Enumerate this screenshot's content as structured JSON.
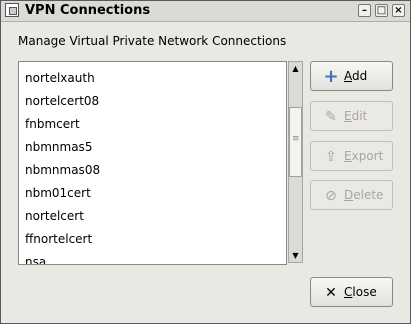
{
  "window": {
    "title": "VPN Connections"
  },
  "heading": "Manage Virtual Private Network Connections",
  "connections": [
    "nortelxauth",
    "nortelcert08",
    "fnbmcert",
    "nbmnmas5",
    "nbmnmas08",
    "nbm01cert",
    "nortelcert",
    "ffnortelcert",
    "nsa"
  ],
  "buttons": {
    "add": {
      "mnemonic": "A",
      "rest": "dd",
      "enabled": true,
      "icon": "plus-icon"
    },
    "edit": {
      "mnemonic": "E",
      "rest": "dit",
      "enabled": false,
      "icon": "edit-icon"
    },
    "export": {
      "mnemonic": "E",
      "rest": "xport",
      "enabled": false,
      "icon": "export-icon"
    },
    "delete": {
      "mnemonic": "D",
      "rest": "elete",
      "enabled": false,
      "icon": "delete-icon"
    },
    "close": {
      "mnemonic": "C",
      "rest": "lose",
      "enabled": true,
      "icon": "close-x-icon"
    }
  },
  "colors": {
    "accent_add_icon": "#3a6fc4",
    "disabled_text": "#a7a59f"
  }
}
